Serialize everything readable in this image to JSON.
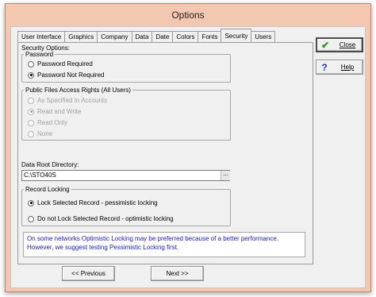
{
  "window": {
    "title": "Options"
  },
  "tabs": [
    {
      "label": "User Interface",
      "active": false
    },
    {
      "label": "Graphics",
      "active": false
    },
    {
      "label": "Company",
      "active": false
    },
    {
      "label": "Data",
      "active": false
    },
    {
      "label": "Date",
      "active": false
    },
    {
      "label": "Colors",
      "active": false
    },
    {
      "label": "Fonts",
      "active": false
    },
    {
      "label": "Security",
      "active": true
    },
    {
      "label": "Users",
      "active": false
    }
  ],
  "security": {
    "title": "Security Options:",
    "password": {
      "legend": "Password",
      "options": [
        {
          "label": "Password Required",
          "selected": false
        },
        {
          "label": "Password Not Required",
          "selected": true
        }
      ]
    },
    "public_files": {
      "legend": "Public Files Access Rights (All Users)",
      "options": [
        {
          "label": "As Specified In Accounts",
          "selected": false
        },
        {
          "label": "Read and Write",
          "selected": true
        },
        {
          "label": "Read Only",
          "selected": false
        },
        {
          "label": "None",
          "selected": false
        }
      ]
    },
    "data_root": {
      "label": "Data Root Directory:",
      "value": "C:\\STO40S",
      "browse_label": "..."
    },
    "record_locking": {
      "legend": "Record Locking",
      "options": [
        {
          "label": "Lock Selected Record - pessimistic locking",
          "selected": true
        },
        {
          "label": "Do not Lock Selected Record - optimistic locking",
          "selected": false
        }
      ]
    },
    "info": "On some networks Optimistic Locking may be preferred because of a better performance. However, we suggest testing Pessimistic Locking first."
  },
  "buttons": {
    "close": "Close",
    "help": "Help",
    "previous": "<< Previous",
    "next": "Next >>"
  },
  "icons": {
    "close": "green-check-icon",
    "help": "question-mark-icon"
  },
  "colors": {
    "title_bar": "#f4c8b0",
    "info_text": "#1a1acc",
    "check_green": "#1f9a1f"
  }
}
